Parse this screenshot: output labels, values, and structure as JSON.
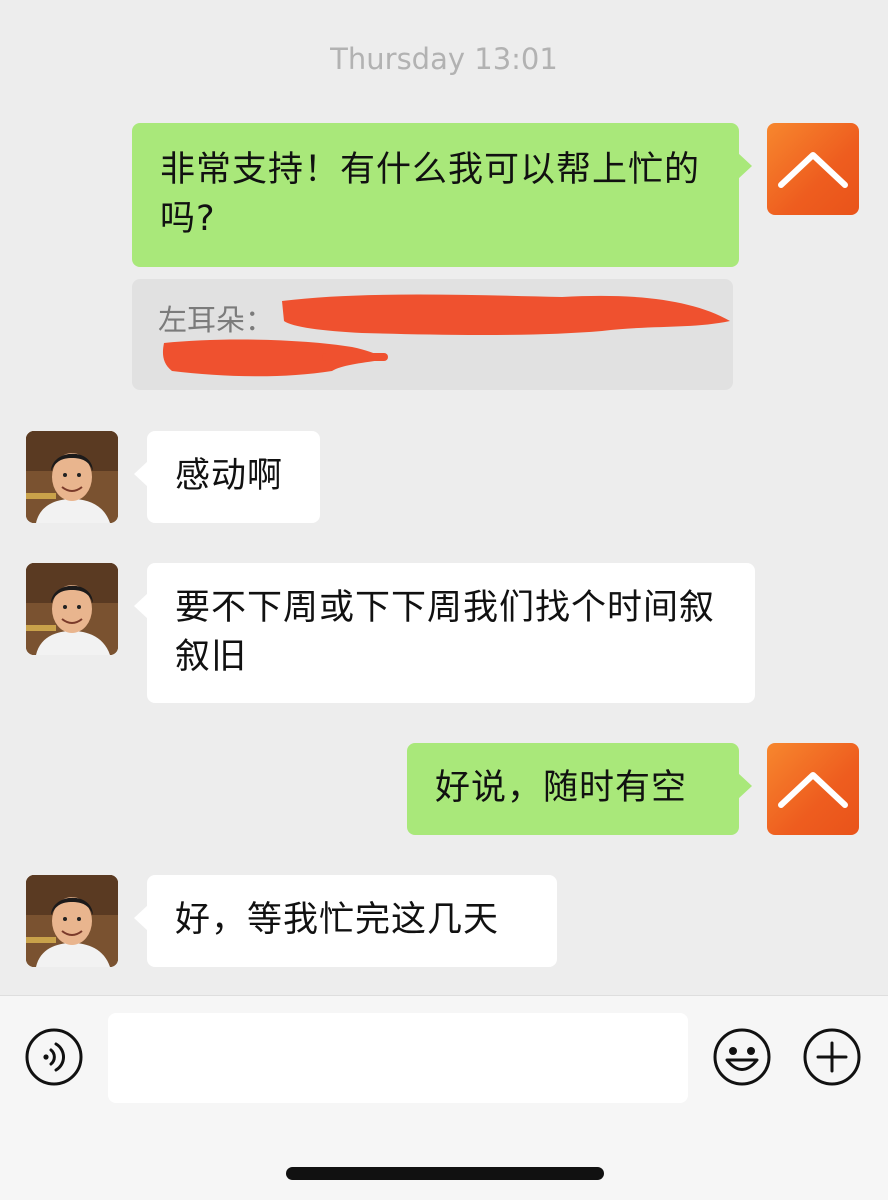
{
  "timestamp": "Thursday 13:01",
  "messages": [
    {
      "from": "self",
      "text": "非常支持！有什么我可以帮上忙的吗?",
      "quote": {
        "label": "左耳朵：",
        "redacted": true
      }
    },
    {
      "from": "friend",
      "text": "感动啊"
    },
    {
      "from": "friend",
      "text": "要不下周或下下周我们找个时间叙叙旧"
    },
    {
      "from": "self",
      "text": "好说，随时有空"
    },
    {
      "from": "friend",
      "text": "好，等我忙完这几天"
    }
  ],
  "input": {
    "value": "",
    "placeholder": ""
  },
  "icons": {
    "voice": "voice-input-icon",
    "emoji": "emoji-icon",
    "more": "plus-icon"
  },
  "colors": {
    "self_bubble": "#a9e87a",
    "friend_bubble": "#ffffff",
    "background": "#ededed",
    "redaction": "#ef512f",
    "self_avatar": "#ee5d1f"
  }
}
